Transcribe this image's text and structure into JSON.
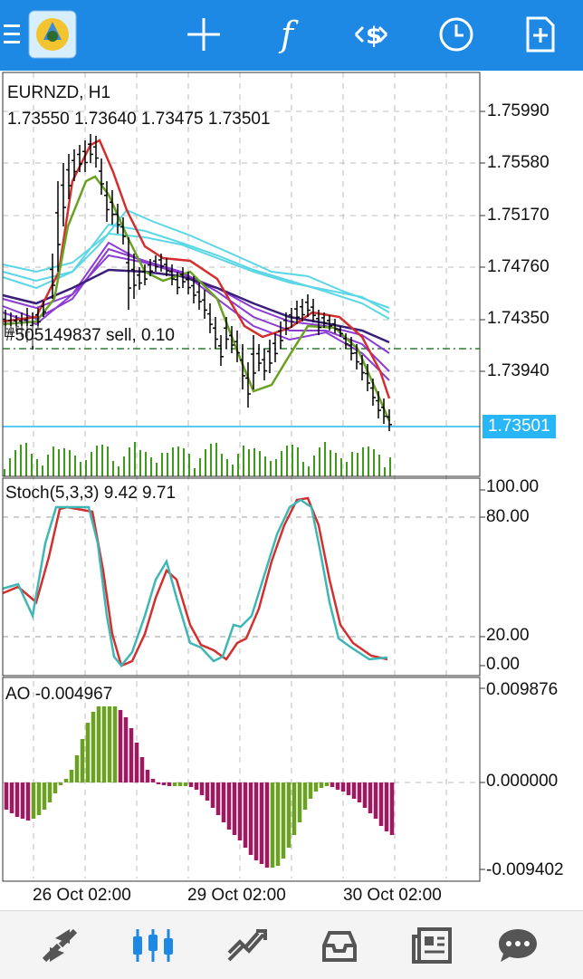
{
  "toolbar": {
    "icons": [
      "menu-icon",
      "app-logo",
      "crosshair-icon",
      "indicators-icon",
      "trade-icon",
      "history-clock-icon",
      "new-document-icon"
    ],
    "indicator_glyph": "f"
  },
  "main_chart": {
    "symbol_label": "EURNZD, H1",
    "ohlc": "1.73550 1.73640 1.73475 1.73501",
    "order_line": "#505149837 sell, 0.10",
    "current_price": "1.73501",
    "price_ticks": [
      "1.75990",
      "1.75580",
      "1.75170",
      "1.74760",
      "1.74350",
      "1.73940"
    ]
  },
  "stoch": {
    "label": "Stoch(5,3,3) 9.42 9.71",
    "ticks": [
      "100.00",
      "80.00",
      "20.00",
      "0.00"
    ]
  },
  "ao": {
    "label": "AO -0.004967",
    "ticks": [
      "0.009876",
      "0.000000",
      "-0.009402"
    ]
  },
  "time_axis": [
    "26 Oct 02:00",
    "29 Oct 02:00",
    "30 Oct 02:00"
  ],
  "bottom_nav": {
    "icons": [
      "quotes-icon",
      "chart-icon",
      "trade-icon",
      "history-icon",
      "news-icon",
      "messages-icon"
    ],
    "active": "chart-icon"
  },
  "colors": {
    "accent": "#1e88e5",
    "red_ma": "#d32f2f",
    "green_ma": "#6aa121",
    "cyan_ma": "#5ad6e6",
    "purple_ma": "#8b3ad6",
    "navy_ma": "#3a1f7a",
    "stoch_main": "#3fb6b6",
    "stoch_signal": "#d32f2f",
    "ao_up": "#6aa121",
    "ao_down": "#a0185f",
    "volume": "#3e9a1b"
  }
}
